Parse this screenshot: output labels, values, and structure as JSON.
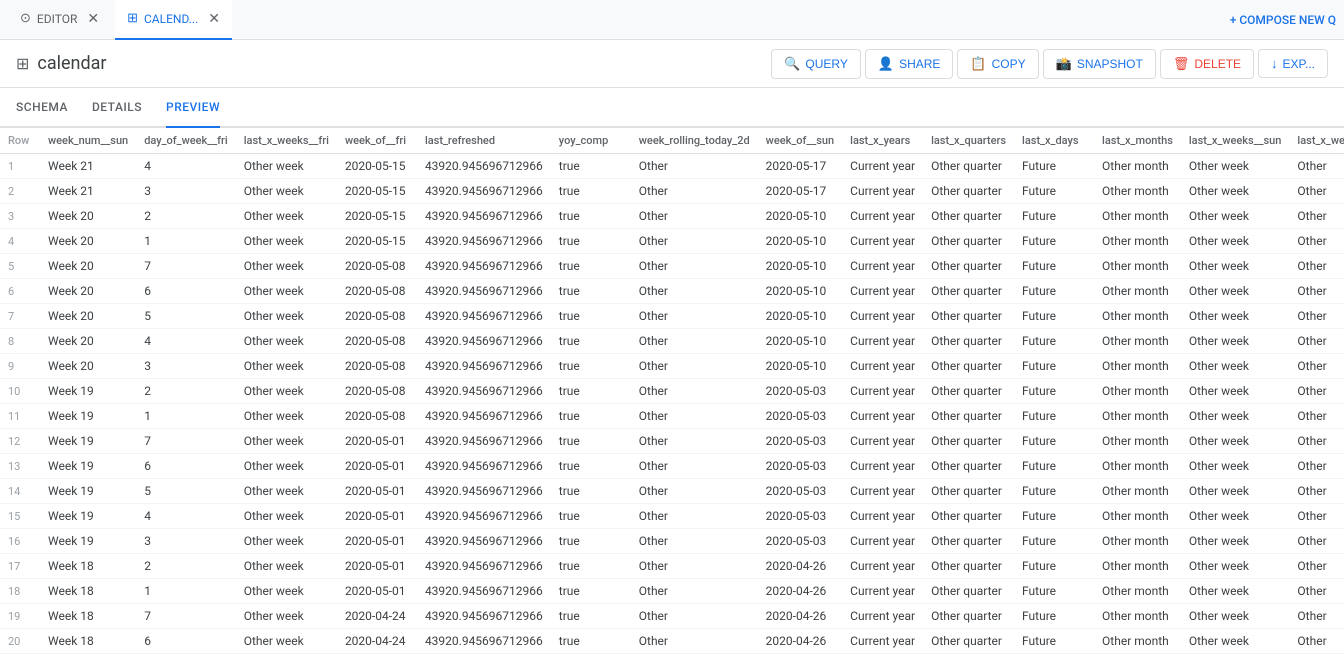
{
  "tabs": [
    {
      "id": "editor",
      "label": "EDITOR",
      "icon": "⊙",
      "active": false,
      "closable": true
    },
    {
      "id": "calendar",
      "label": "CALEND...",
      "icon": "⊞",
      "active": true,
      "closable": true
    }
  ],
  "compose_btn": "+ COMPOSE NEW Q",
  "page": {
    "icon": "⊞",
    "title": "calendar"
  },
  "actions": [
    {
      "id": "query",
      "icon": "🔍",
      "label": "QUERY"
    },
    {
      "id": "share",
      "icon": "👤+",
      "label": "SHARE"
    },
    {
      "id": "copy",
      "icon": "📋",
      "label": "COPY"
    },
    {
      "id": "snapshot",
      "icon": "📸",
      "label": "SNAPSHOT"
    },
    {
      "id": "delete",
      "icon": "🗑",
      "label": "DELETE",
      "danger": true
    },
    {
      "id": "export",
      "icon": "↓",
      "label": "EXP..."
    }
  ],
  "sub_nav": [
    {
      "id": "schema",
      "label": "SCHEMA",
      "active": false
    },
    {
      "id": "details",
      "label": "DETAILS",
      "active": false
    },
    {
      "id": "preview",
      "label": "PREVIEW",
      "active": true
    }
  ],
  "table": {
    "columns": [
      "Row",
      "week_num__sun",
      "day_of_week__fri",
      "last_x_weeks__fri",
      "week_of__fri",
      "last_refreshed",
      "yoy_comp",
      "week_rolling_today_2d",
      "week_of__sun",
      "last_x_years",
      "last_x_quarters",
      "last_x_days",
      "last_x_months",
      "last_x_weeks__sun",
      "last_x_weeks_rollin"
    ],
    "rows": [
      [
        1,
        "Week 21",
        4,
        "Other week",
        "2020-05-15",
        "43920.945696712966",
        "true",
        "Other",
        "2020-05-17",
        "Current year",
        "Other quarter",
        "Future",
        "Other month",
        "Other week",
        "Other"
      ],
      [
        2,
        "Week 21",
        3,
        "Other week",
        "2020-05-15",
        "43920.945696712966",
        "true",
        "Other",
        "2020-05-17",
        "Current year",
        "Other quarter",
        "Future",
        "Other month",
        "Other week",
        "Other"
      ],
      [
        3,
        "Week 20",
        2,
        "Other week",
        "2020-05-15",
        "43920.945696712966",
        "true",
        "Other",
        "2020-05-10",
        "Current year",
        "Other quarter",
        "Future",
        "Other month",
        "Other week",
        "Other"
      ],
      [
        4,
        "Week 20",
        1,
        "Other week",
        "2020-05-15",
        "43920.945696712966",
        "true",
        "Other",
        "2020-05-10",
        "Current year",
        "Other quarter",
        "Future",
        "Other month",
        "Other week",
        "Other"
      ],
      [
        5,
        "Week 20",
        7,
        "Other week",
        "2020-05-08",
        "43920.945696712966",
        "true",
        "Other",
        "2020-05-10",
        "Current year",
        "Other quarter",
        "Future",
        "Other month",
        "Other week",
        "Other"
      ],
      [
        6,
        "Week 20",
        6,
        "Other week",
        "2020-05-08",
        "43920.945696712966",
        "true",
        "Other",
        "2020-05-10",
        "Current year",
        "Other quarter",
        "Future",
        "Other month",
        "Other week",
        "Other"
      ],
      [
        7,
        "Week 20",
        5,
        "Other week",
        "2020-05-08",
        "43920.945696712966",
        "true",
        "Other",
        "2020-05-10",
        "Current year",
        "Other quarter",
        "Future",
        "Other month",
        "Other week",
        "Other"
      ],
      [
        8,
        "Week 20",
        4,
        "Other week",
        "2020-05-08",
        "43920.945696712966",
        "true",
        "Other",
        "2020-05-10",
        "Current year",
        "Other quarter",
        "Future",
        "Other month",
        "Other week",
        "Other"
      ],
      [
        9,
        "Week 20",
        3,
        "Other week",
        "2020-05-08",
        "43920.945696712966",
        "true",
        "Other",
        "2020-05-10",
        "Current year",
        "Other quarter",
        "Future",
        "Other month",
        "Other week",
        "Other"
      ],
      [
        10,
        "Week 19",
        2,
        "Other week",
        "2020-05-08",
        "43920.945696712966",
        "true",
        "Other",
        "2020-05-03",
        "Current year",
        "Other quarter",
        "Future",
        "Other month",
        "Other week",
        "Other"
      ],
      [
        11,
        "Week 19",
        1,
        "Other week",
        "2020-05-08",
        "43920.945696712966",
        "true",
        "Other",
        "2020-05-03",
        "Current year",
        "Other quarter",
        "Future",
        "Other month",
        "Other week",
        "Other"
      ],
      [
        12,
        "Week 19",
        7,
        "Other week",
        "2020-05-01",
        "43920.945696712966",
        "true",
        "Other",
        "2020-05-03",
        "Current year",
        "Other quarter",
        "Future",
        "Other month",
        "Other week",
        "Other"
      ],
      [
        13,
        "Week 19",
        6,
        "Other week",
        "2020-05-01",
        "43920.945696712966",
        "true",
        "Other",
        "2020-05-03",
        "Current year",
        "Other quarter",
        "Future",
        "Other month",
        "Other week",
        "Other"
      ],
      [
        14,
        "Week 19",
        5,
        "Other week",
        "2020-05-01",
        "43920.945696712966",
        "true",
        "Other",
        "2020-05-03",
        "Current year",
        "Other quarter",
        "Future",
        "Other month",
        "Other week",
        "Other"
      ],
      [
        15,
        "Week 19",
        4,
        "Other week",
        "2020-05-01",
        "43920.945696712966",
        "true",
        "Other",
        "2020-05-03",
        "Current year",
        "Other quarter",
        "Future",
        "Other month",
        "Other week",
        "Other"
      ],
      [
        16,
        "Week 19",
        3,
        "Other week",
        "2020-05-01",
        "43920.945696712966",
        "true",
        "Other",
        "2020-05-03",
        "Current year",
        "Other quarter",
        "Future",
        "Other month",
        "Other week",
        "Other"
      ],
      [
        17,
        "Week 18",
        2,
        "Other week",
        "2020-05-01",
        "43920.945696712966",
        "true",
        "Other",
        "2020-04-26",
        "Current year",
        "Other quarter",
        "Future",
        "Other month",
        "Other week",
        "Other"
      ],
      [
        18,
        "Week 18",
        1,
        "Other week",
        "2020-05-01",
        "43920.945696712966",
        "true",
        "Other",
        "2020-04-26",
        "Current year",
        "Other quarter",
        "Future",
        "Other month",
        "Other week",
        "Other"
      ],
      [
        19,
        "Week 18",
        7,
        "Other week",
        "2020-04-24",
        "43920.945696712966",
        "true",
        "Other",
        "2020-04-26",
        "Current year",
        "Other quarter",
        "Future",
        "Other month",
        "Other week",
        "Other"
      ],
      [
        20,
        "Week 18",
        6,
        "Other week",
        "2020-04-24",
        "43920.945696712966",
        "true",
        "Other",
        "2020-04-26",
        "Current year",
        "Other quarter",
        "Future",
        "Other month",
        "Other week",
        "Other"
      ]
    ]
  }
}
